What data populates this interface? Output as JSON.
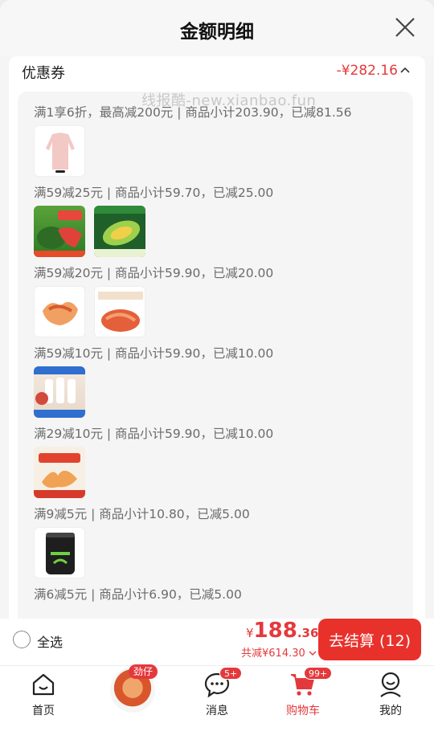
{
  "sheet": {
    "title": "金额明细",
    "watermark": "线报酷-new.xianbao.fun"
  },
  "coupon": {
    "label": "优惠券",
    "total": "-¥282.16",
    "groups": [
      {
        "desc": "满1享6折，最高减200元 | 商品小计203.90，已减81.56",
        "items": [
          "pink-jacket"
        ]
      },
      {
        "desc": "满59减25元 | 商品小计59.70，已减25.00",
        "items": [
          "watermelon-box",
          "melon-box"
        ]
      },
      {
        "desc": "满59减20元 | 商品小计59.90，已减20.00",
        "items": [
          "spicy-chicken-feet",
          "spicy-snack-pack"
        ]
      },
      {
        "desc": "满59减10元 | 商品小计59.90，已减10.00",
        "items": [
          "milk-bottles"
        ]
      },
      {
        "desc": "满29减10元 | 商品小计59.90，已减10.00",
        "items": [
          "boneless-feet"
        ]
      },
      {
        "desc": "满9减5元 | 商品小计10.80，已减5.00",
        "items": [
          "trash-bags"
        ]
      },
      {
        "desc": "满6减5元 | 商品小计6.90，已减5.00",
        "items": []
      }
    ]
  },
  "bottom": {
    "select_all": "全选",
    "yen": "¥",
    "price_int": "188",
    "price_dec": ".36",
    "saved": "共减¥614.30",
    "checkout": "去结算 (12)"
  },
  "tabs": [
    {
      "label": "首页",
      "icon": "home-icon",
      "active": false
    },
    {
      "label": "",
      "icon": "promo-icon",
      "tag": "劲仔"
    },
    {
      "label": "消息",
      "icon": "message-icon",
      "badge": "5+"
    },
    {
      "label": "购物车",
      "icon": "cart-icon",
      "badge": "99+",
      "active": true
    },
    {
      "label": "我的",
      "icon": "profile-icon"
    }
  ],
  "colors": {
    "accent": "#e4393c",
    "checkout": "#e8312b"
  }
}
